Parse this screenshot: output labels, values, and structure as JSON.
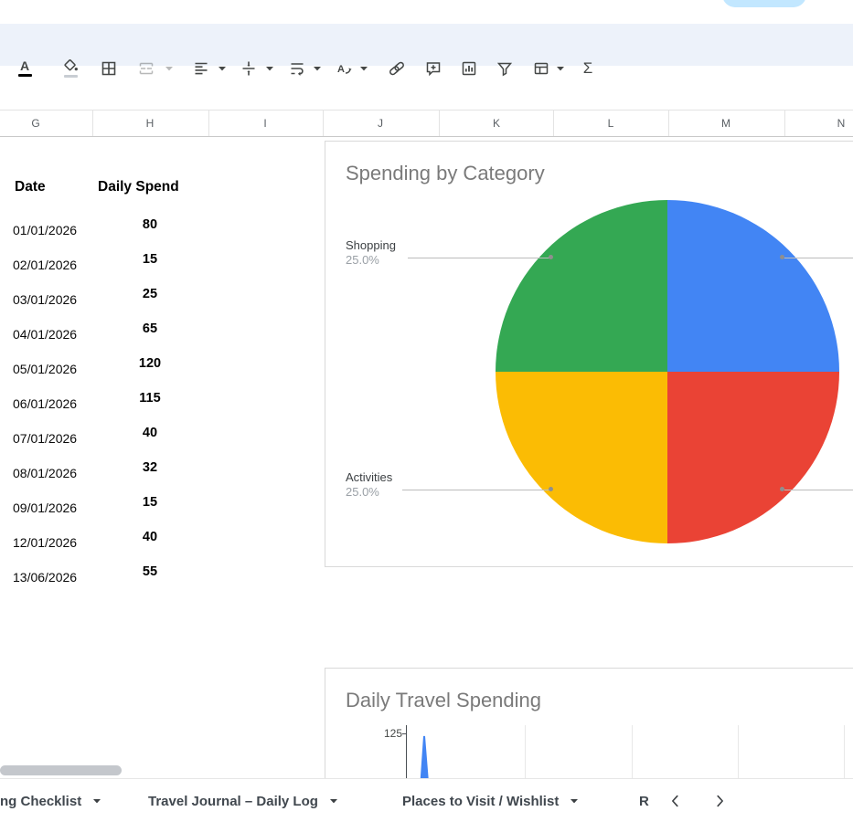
{
  "toolbar": {
    "buttons": [
      {
        "icon": "text-color-icon",
        "dropdown": false,
        "disabled": false
      },
      {
        "icon": "fill-color-icon",
        "dropdown": false,
        "disabled": false
      },
      {
        "icon": "borders-icon",
        "dropdown": false,
        "disabled": false
      },
      {
        "icon": "merge-cells-icon",
        "dropdown": true,
        "disabled": true
      },
      {
        "icon": "horizontal-align-icon",
        "dropdown": true,
        "disabled": false
      },
      {
        "icon": "vertical-align-icon",
        "dropdown": true,
        "disabled": false
      },
      {
        "icon": "text-wrapping-icon",
        "dropdown": true,
        "disabled": false
      },
      {
        "icon": "text-rotation-icon",
        "dropdown": true,
        "disabled": false
      },
      {
        "icon": "insert-link-icon",
        "dropdown": false,
        "disabled": false
      },
      {
        "icon": "insert-comment-icon",
        "dropdown": false,
        "disabled": false
      },
      {
        "icon": "insert-chart-icon",
        "dropdown": false,
        "disabled": false
      },
      {
        "icon": "create-filter-icon",
        "dropdown": false,
        "disabled": false
      },
      {
        "icon": "table-views-icon",
        "dropdown": true,
        "disabled": false
      },
      {
        "icon": "functions-icon",
        "glyph": "Σ",
        "dropdown": false,
        "disabled": false
      }
    ]
  },
  "column_headers": [
    "G",
    "H",
    "I",
    "J",
    "K",
    "L",
    "M",
    "N"
  ],
  "table": {
    "headers": [
      "Date",
      "Daily Spend"
    ],
    "rows": [
      {
        "date": "01/01/2026",
        "spend": "80"
      },
      {
        "date": "02/01/2026",
        "spend": "15"
      },
      {
        "date": "03/01/2026",
        "spend": "25"
      },
      {
        "date": "04/01/2026",
        "spend": "65"
      },
      {
        "date": "05/01/2026",
        "spend": "120"
      },
      {
        "date": "06/01/2026",
        "spend": "115"
      },
      {
        "date": "07/01/2026",
        "spend": "40"
      },
      {
        "date": "08/01/2026",
        "spend": "32"
      },
      {
        "date": "09/01/2026",
        "spend": "15"
      },
      {
        "date": "12/01/2026",
        "spend": "40"
      },
      {
        "date": "13/06/2026",
        "spend": "55"
      }
    ]
  },
  "chart_data": [
    {
      "type": "pie",
      "title": "Spending by Category",
      "slices": [
        {
          "label": "",
          "value": 25,
          "color": "#4285f4",
          "percent_label": ""
        },
        {
          "label": "",
          "value": 25,
          "color": "#ea4335",
          "percent_label": ""
        },
        {
          "label": "Activities",
          "value": 25,
          "color": "#fbbc04",
          "percent_label": "25.0%"
        },
        {
          "label": "Shopping",
          "value": 25,
          "color": "#34a853",
          "percent_label": "25.0%"
        }
      ],
      "legend_position": "outside-labels"
    },
    {
      "type": "line",
      "title": "Daily Travel Spending",
      "y_ticks": [
        "125"
      ],
      "series_color": "#4285f4",
      "gridlines": "vertical"
    }
  ],
  "sheet_tabs": {
    "tabs": [
      {
        "label": "ng Checklist",
        "has_menu": true
      },
      {
        "label": "Travel Journal – Daily Log",
        "has_menu": true
      },
      {
        "label": "Places to Visit / Wishlist",
        "has_menu": true
      },
      {
        "label": "R",
        "has_menu": false
      }
    ],
    "nav": {
      "prev_icon": "chevron-left-icon",
      "next_icon": "chevron-right-icon"
    }
  },
  "colors": {
    "toolbar_bg": "#edf2fa",
    "share_pill": "#c2e7ff",
    "pie_blue": "#4285f4",
    "pie_red": "#ea4335",
    "pie_yellow": "#fbbc04",
    "pie_green": "#34a853",
    "chart_title_gray": "#7a7a7a",
    "scrollbar_thumb": "#c4c7cc"
  }
}
